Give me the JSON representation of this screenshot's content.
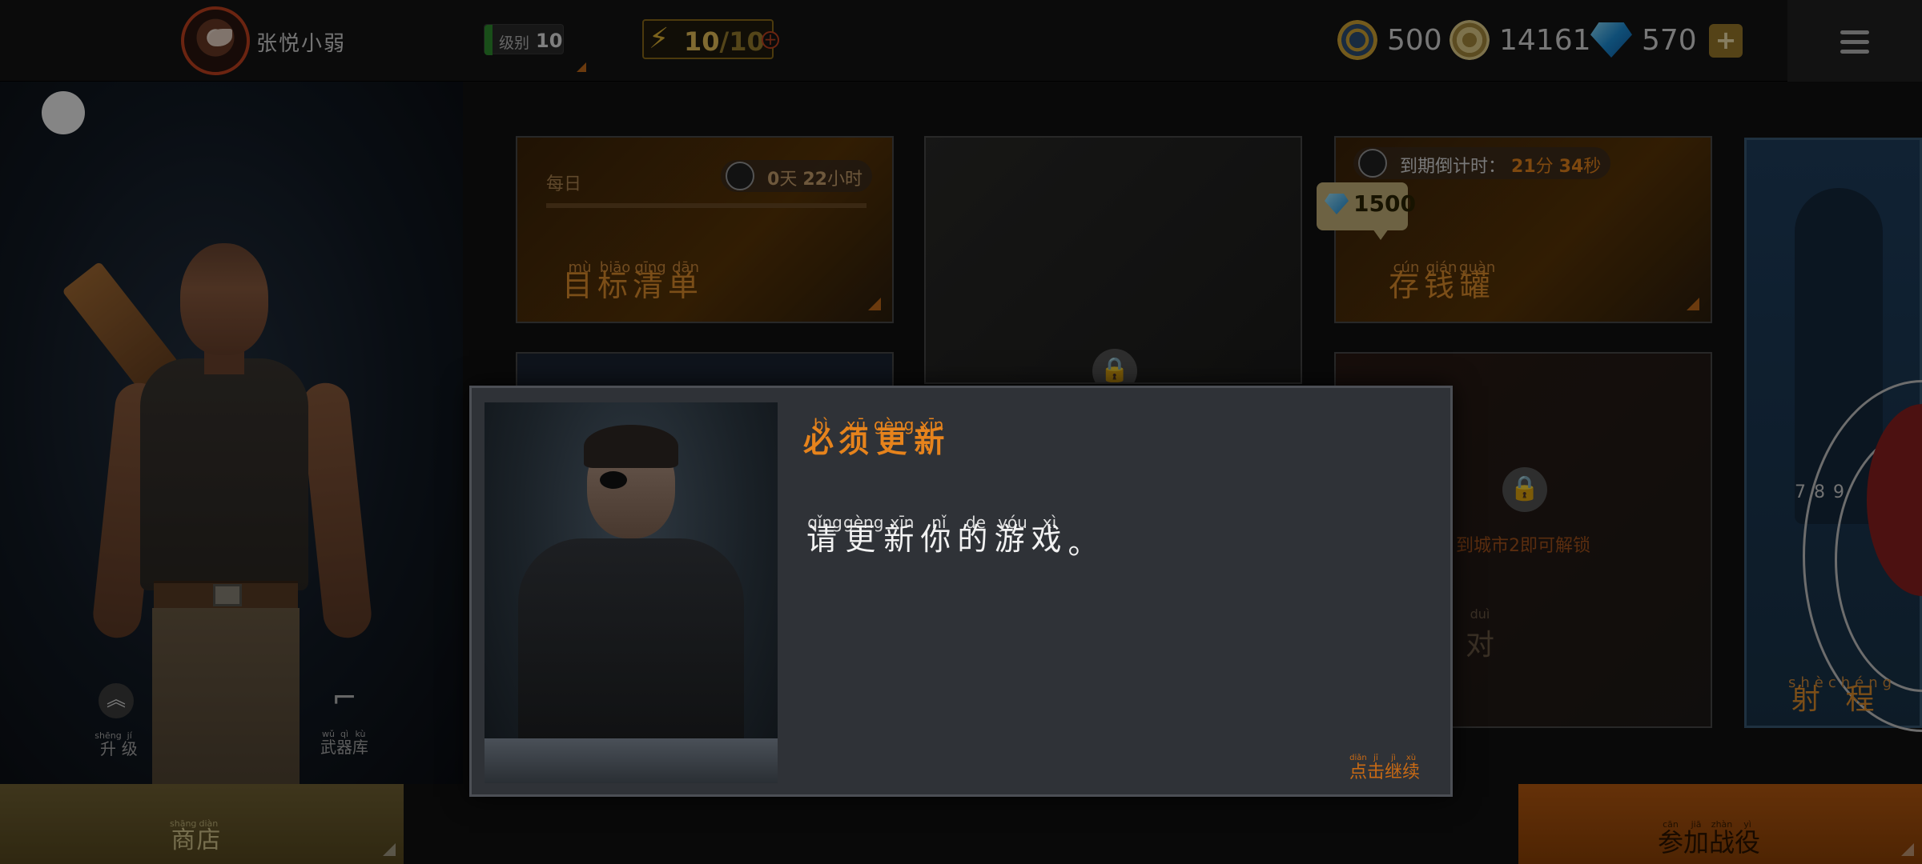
{
  "header": {
    "player_name": "张悦小弱",
    "level_label": "级别",
    "level_value": "10",
    "energy_current": "10",
    "energy_separator": "/",
    "energy_max": "10",
    "energy_plus": "+",
    "medals": "500",
    "coins": "14161",
    "gems": "570",
    "add_label": "+"
  },
  "cards": {
    "daily_label": "每日",
    "daily_timer_days": "0",
    "daily_timer_day_unit": "天",
    "daily_timer_hours": "22",
    "daily_timer_hour_unit": "小时",
    "target_list": {
      "title": [
        "目",
        "标",
        "清",
        "单"
      ],
      "pinyin": [
        "mù",
        "biāo",
        "qīng",
        "dān"
      ]
    },
    "piggy_countdown_label": "到期倒计时：",
    "piggy_minutes": "21",
    "piggy_minute_unit": "分",
    "piggy_seconds": "34",
    "piggy_second_unit": "秒",
    "piggy_gems": "1500",
    "piggy_bank": {
      "title": [
        "存",
        "钱",
        "罐"
      ],
      "pinyin": [
        "cún",
        "qián",
        "guàn"
      ]
    },
    "city_unlock": "到城市2即可解锁",
    "versus_char": "对",
    "versus_pinyin": "duì",
    "range": {
      "title": [
        "射",
        "程"
      ],
      "pinyin": [
        "shè",
        "chéng"
      ]
    },
    "target_numbers": [
      "7",
      "8",
      "9"
    ]
  },
  "left": {
    "upgrade": {
      "label": [
        "升",
        "级"
      ],
      "pinyin": [
        "shēng",
        "jí"
      ]
    },
    "armory": {
      "label": [
        "武",
        "器",
        "库"
      ],
      "pinyin": [
        "wǔ",
        "qì",
        "kù"
      ]
    }
  },
  "bottom": {
    "shop": {
      "label": [
        "商",
        "店"
      ],
      "pinyin": [
        "shāng",
        "diàn"
      ]
    },
    "campaign": {
      "label": [
        "参",
        "加",
        "战",
        "役"
      ],
      "pinyin": [
        "cān",
        "jiā",
        "zhàn",
        "yì"
      ]
    }
  },
  "dialog": {
    "title": {
      "chars": [
        "必",
        "须",
        "更",
        "新"
      ],
      "pinyin": [
        "bì",
        "xū",
        "gèng",
        "xīn"
      ]
    },
    "message": {
      "chars": [
        "请",
        "更",
        "新",
        "你",
        "的",
        "游",
        "戏",
        "。"
      ],
      "pinyin": [
        "qǐng",
        "gèng",
        "xīn",
        "nǐ",
        "de",
        "yóu",
        "xì",
        ""
      ]
    },
    "continue": {
      "chars": [
        "点",
        "击",
        "继",
        "续"
      ],
      "pinyin": [
        "diǎn",
        "jī",
        "jì",
        "xù"
      ]
    }
  },
  "colors": {
    "accent": "#e6831c",
    "gold": "#e9c15a",
    "panel": "#2f3237"
  },
  "icons": [
    "medal-icon",
    "coin-icon",
    "gem-icon",
    "menu-icon",
    "lock-icon",
    "clock-icon",
    "upgrade-icon",
    "gun-icon",
    "lightning-icon"
  ]
}
